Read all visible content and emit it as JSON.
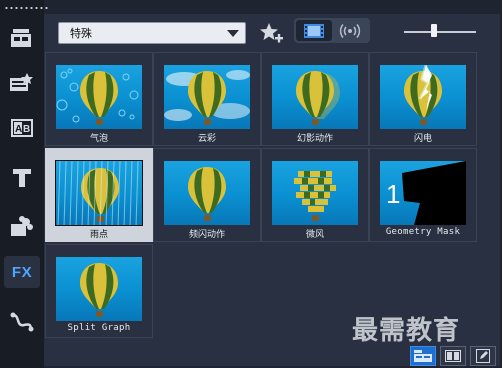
{
  "toolbar": {
    "category_value": "特殊",
    "view_modes": [
      "video-mode-icon",
      "audio-mode-icon"
    ]
  },
  "sidebar": {
    "tools": [
      {
        "name": "media",
        "icon": "media-library-icon"
      },
      {
        "name": "instant-project",
        "icon": "instant-project-icon"
      },
      {
        "name": "transition",
        "icon": "transition-icon"
      },
      {
        "name": "title",
        "icon": "title-icon"
      },
      {
        "name": "graphic",
        "icon": "graphic-icon"
      },
      {
        "name": "filter",
        "icon": "fx-icon",
        "label": "FX",
        "active": true
      },
      {
        "name": "path",
        "icon": "motion-path-icon"
      }
    ]
  },
  "effects": [
    {
      "label": "气泡",
      "style": "bubbles"
    },
    {
      "label": "云彩",
      "style": "clouds"
    },
    {
      "label": "幻影动作",
      "style": "ghost"
    },
    {
      "label": "闪电",
      "style": "lightning"
    },
    {
      "label": "雨点",
      "style": "rain",
      "selected": true
    },
    {
      "label": "频闪动作",
      "style": "strobe"
    },
    {
      "label": "微风",
      "style": "breeze"
    },
    {
      "label": "Geometry Mask",
      "style": "geometry",
      "mono": true
    },
    {
      "label": "Split Graph",
      "style": "split",
      "mono": true
    }
  ],
  "watermark": "最需教育",
  "colors": {
    "accent": "#1e6fcf",
    "panel": "#283041",
    "sidebar": "#171c25",
    "fx": "#4da6ff"
  }
}
